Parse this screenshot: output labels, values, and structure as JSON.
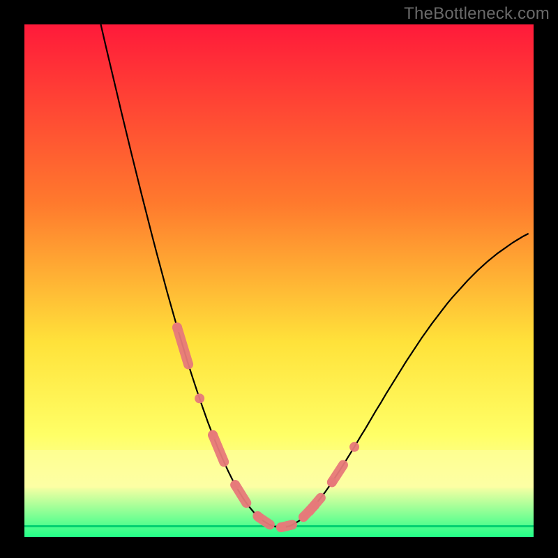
{
  "attribution": "TheBottleneck.com",
  "colors": {
    "frame": "#000000",
    "gradient_top": "#ff1a3a",
    "gradient_mid1": "#ff7a2d",
    "gradient_mid2": "#ffe23a",
    "gradient_mid3": "#ffff66",
    "gradient_band_pale": "#fdffa4",
    "gradient_bottom": "#22ff88",
    "curve": "#000000",
    "dots": "#e77a7a",
    "dots_stroke": "#d46a6a"
  },
  "chart_data": {
    "type": "line",
    "title": "",
    "xlabel": "",
    "ylabel": "",
    "xlim": [
      0,
      100
    ],
    "ylim": [
      0,
      100
    ],
    "x": [
      0,
      1,
      2,
      3,
      4,
      5,
      6,
      7,
      8,
      9,
      10,
      11,
      12,
      13,
      14,
      15,
      16,
      17,
      18,
      19,
      20,
      21,
      22,
      23,
      24,
      25,
      26,
      27,
      28,
      29,
      30,
      31,
      32,
      33,
      34,
      35,
      36,
      37,
      38,
      39,
      40,
      41,
      42,
      43,
      44,
      45,
      46,
      47,
      48,
      49,
      50,
      51,
      52,
      53,
      54,
      55,
      56,
      57,
      58,
      59,
      60,
      61,
      62,
      63,
      64,
      65,
      66,
      67,
      68,
      69,
      70,
      71,
      72,
      73,
      74,
      75,
      76,
      77,
      78,
      79,
      80,
      81,
      82,
      83,
      84,
      85,
      86,
      87,
      88,
      89,
      90,
      91,
      92,
      93,
      94,
      95,
      96,
      97,
      98,
      99,
      100
    ],
    "series": [
      {
        "name": "curve",
        "values": [
          null,
          null,
          null,
          null,
          null,
          null,
          null,
          null,
          null,
          null,
          null,
          null,
          null,
          null,
          null,
          100,
          95.7,
          91.5,
          87.3,
          83.1,
          79,
          74.9,
          70.9,
          66.9,
          63,
          59.1,
          55.3,
          51.6,
          47.9,
          44.4,
          40.9,
          37.6,
          34.3,
          31.2,
          28.2,
          25.3,
          22.5,
          19.9,
          17.4,
          15.1,
          12.9,
          10.9,
          9.1,
          7.5,
          6.1,
          4.9,
          3.9,
          3.1,
          2.5,
          2.1,
          1.9,
          1.9,
          2.1,
          2.6,
          3.2,
          4.1,
          5.1,
          6.2,
          7.4,
          8.7,
          10.1,
          11.6,
          13.1,
          14.7,
          16.3,
          17.9,
          19.6,
          21.2,
          22.9,
          24.6,
          26.2,
          27.9,
          29.5,
          31.1,
          32.7,
          34.3,
          35.8,
          37.3,
          38.8,
          40.2,
          41.6,
          42.9,
          44.2,
          45.5,
          46.7,
          47.8,
          48.9,
          50,
          51,
          52,
          52.9,
          53.8,
          54.6,
          55.4,
          56.1,
          56.8,
          57.5,
          58.1,
          58.7,
          59.2
        ]
      }
    ],
    "highlight_ranges": [
      {
        "x_start": 30,
        "x_end": 35,
        "side": "left"
      },
      {
        "x_start": 37,
        "x_end": 47,
        "side": "left"
      },
      {
        "x_start": 46,
        "x_end": 57,
        "side": "bottom"
      },
      {
        "x_start": 56,
        "x_end": 66,
        "side": "right"
      }
    ],
    "gradient_stops": [
      {
        "pos": 0.0,
        "value": 100
      },
      {
        "pos": 0.35,
        "value": 65
      },
      {
        "pos": 0.62,
        "value": 38
      },
      {
        "pos": 0.8,
        "value": 20
      },
      {
        "pos": 0.9,
        "value": 10
      },
      {
        "pos": 1.0,
        "value": 0
      }
    ]
  }
}
